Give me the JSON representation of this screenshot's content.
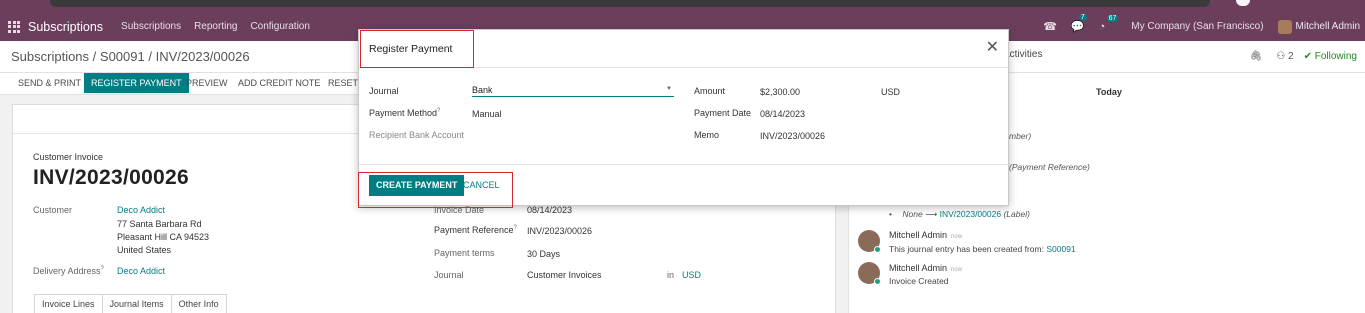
{
  "navbar": {
    "app_name": "Subscriptions",
    "menus": [
      "Subscriptions",
      "Reporting",
      "Configuration"
    ],
    "messages_count": "7",
    "activities_count": "67",
    "company": "My Company (San Francisco)",
    "user": "Mitchell Admin"
  },
  "control": {
    "breadcrumb": [
      "Subscriptions",
      "S00091",
      "INV/2023/00026"
    ],
    "activities_label": "Activities",
    "followers_count": "2",
    "following_label": "Following"
  },
  "actions": {
    "send_print": "SEND & PRINT",
    "register_payment": "REGISTER PAYMENT",
    "preview": "PREVIEW",
    "add_credit_note": "ADD CREDIT NOTE",
    "reset": "RESET T"
  },
  "invoice": {
    "type": "Customer Invoice",
    "number": "INV/2023/00026",
    "customer_label": "Customer",
    "customer_name": "Deco Addict",
    "address_line1": "77 Santa Barbara Rd",
    "address_line2": "Pleasant Hill CA 94523",
    "address_line3": "United States",
    "delivery_label": "Delivery Address",
    "delivery_value": "Deco Addict",
    "invoice_date_label": "Invoice Date",
    "invoice_date_value": "08/14/2023",
    "payment_reference_label": "Payment Reference",
    "payment_reference_value": "INV/2023/00026",
    "payment_terms_label": "Payment terms",
    "payment_terms_value": "30 Days",
    "journal_label": "Journal",
    "journal_value": "Customer Invoices",
    "journal_in": "in",
    "journal_currency": "USD",
    "tabs": [
      "Invoice Lines",
      "Journal Items",
      "Other Info"
    ]
  },
  "chatter": {
    "today": "Today",
    "frag1": "mber)",
    "frag2": "(Payment Reference)",
    "change_old": "None",
    "change_new": "INV/2023/00026",
    "change_field": "(Label)",
    "msg1_author": "Mitchell Admin",
    "msg1_time": "now",
    "msg1_body": "This journal entry has been created from:",
    "msg1_link": "S00091",
    "msg2_author": "Mitchell Admin",
    "msg2_time": "now",
    "msg2_body": "Invoice Created"
  },
  "modal": {
    "title": "Register Payment",
    "journal_label": "Journal",
    "journal_value": "Bank",
    "payment_method_label": "Payment Method",
    "payment_method_value": "Manual",
    "recipient_label": "Recipient Bank Account",
    "amount_label": "Amount",
    "amount_value": "$2,300.00",
    "currency": "USD",
    "payment_date_label": "Payment Date",
    "payment_date_value": "08/14/2023",
    "memo_label": "Memo",
    "memo_value": "INV/2023/00026",
    "create_button": "CREATE PAYMENT",
    "cancel_button": "CANCEL"
  },
  "colors": {
    "brand": "#6b3f5c",
    "primary": "#017e84",
    "highlight": "#d6282f"
  }
}
